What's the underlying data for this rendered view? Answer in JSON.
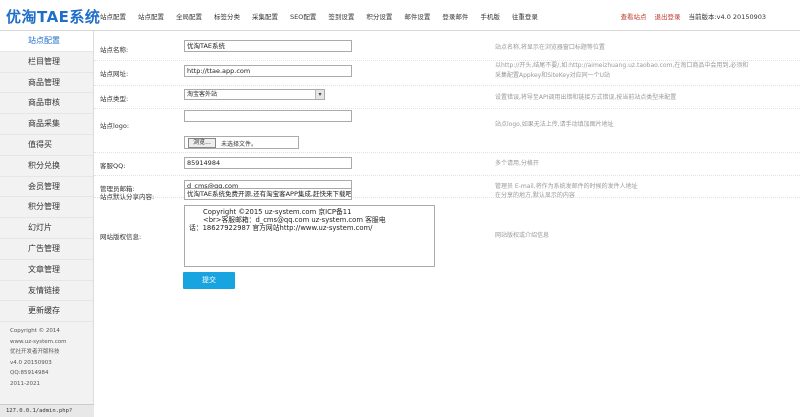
{
  "app": {
    "logo": "优淘TAE系统"
  },
  "topnav": [
    "站点配置",
    "站点配置",
    "全局配置",
    "标签分类",
    "采集配置",
    "SEO配置",
    "签到设置",
    "积分设置",
    "邮件设置",
    "登录邮件",
    "手机版",
    "往重登录"
  ],
  "topright": {
    "view_site": "查看站点",
    "logout": "退出登录",
    "version": "当前版本:v4.0 20150903"
  },
  "sidebar": {
    "items": [
      "站点配置",
      "栏目管理",
      "商品管理",
      "商品审核",
      "商品采集",
      "值得买",
      "积分兑换",
      "会员管理",
      "积分管理",
      "幻灯片",
      "广告管理",
      "文章管理",
      "友情链接",
      "更新缓存"
    ],
    "footer": [
      "Copyright © 2014",
      "www.uz-system.com",
      "优社开发者开版科技",
      "v4.0 20150903",
      "QQ:85914984",
      "2011-2021"
    ]
  },
  "statusbar": "127.0.0.1/admin.php?",
  "form": {
    "site_name": {
      "label": "站点名称:",
      "value": "优淘TAE系统",
      "hint": "站点名称,将显示在浏览器窗口标题等位置"
    },
    "site_url": {
      "label": "站点网址:",
      "value": "http://ttae.app.com",
      "hint_line1": "以http://开头,结尾不要/,如:http://aimeizhuang.uz.taobao.com,在淘口商品中会用到,必须和",
      "hint_line2": "采集配置Appkey和SiteKey对应同一个U站"
    },
    "site_type": {
      "label": "站点类型:",
      "value": "淘宝客外站",
      "hint": "设置错误,将导至API调用出错和链接方式错误,按当前站点类型来配置"
    },
    "site_logo": {
      "label": "站点logo:",
      "browse_label": "浏览...",
      "file_status": "未选择文件。",
      "hint": "站点logo,如果无法上传,请手动填加图片地址"
    },
    "qq": {
      "label": "客服QQ:",
      "value": "85914984",
      "hint": "多个请用,分格开"
    },
    "admin_email": {
      "label": "管理员邮箱:",
      "value": "d_cms@qq.com",
      "hint": "管理员 E-mail,将作为系统发邮件的时候的发件人地址"
    },
    "share": {
      "label": "站点默认分享内容:",
      "value": "优淘TAE系统免费开源,还有淘宝客APP集成,赶快来下载吧!",
      "hint": "在分享的地方,默认显示的内容"
    },
    "copyright": {
      "label": "网站版权信息:",
      "line1": "Copyright ©2015 uz-system.com    京ICP备11",
      "line2": "<br>客服邮箱：d_cms@qq.com uz-system.com 客服电",
      "line3": "话：18627922987 官方网站http://www.uz-system.com/",
      "hint": "网站版权或介绍信息"
    },
    "submit_label": "提交"
  }
}
